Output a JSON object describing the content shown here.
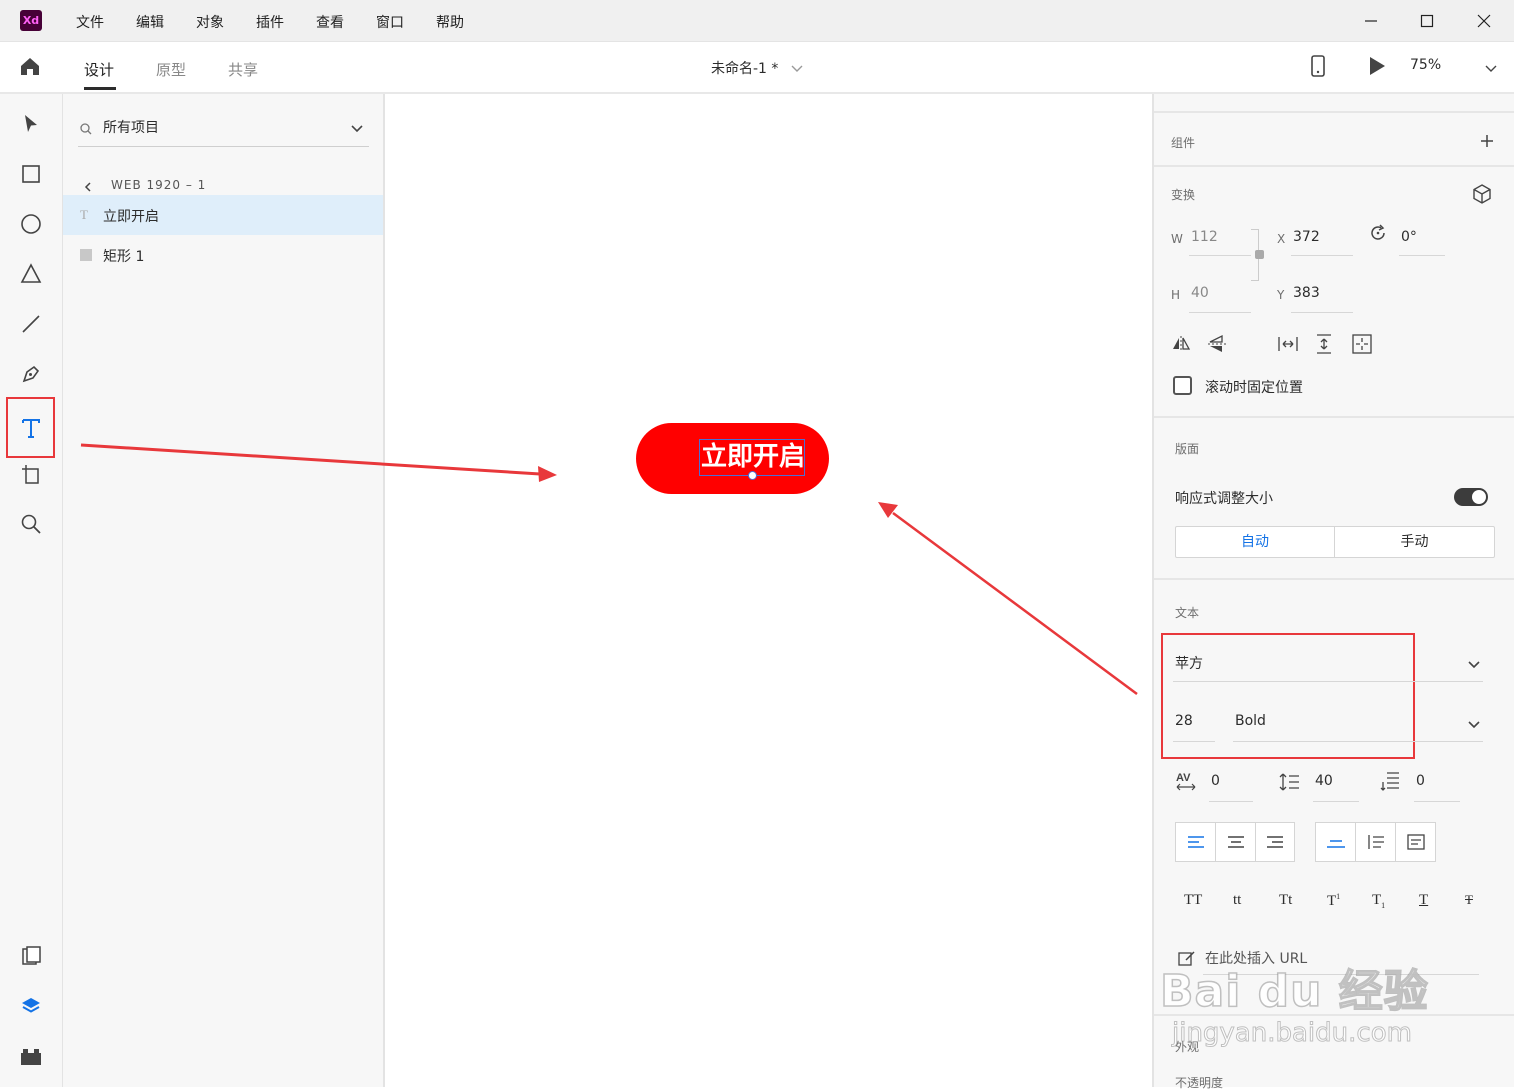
{
  "app": {
    "logo": "Xd",
    "colors": {
      "accent": "#1473e6",
      "button_red": "#ff0000",
      "annotation": "#e8383b"
    }
  },
  "menu": [
    "文件",
    "编辑",
    "对象",
    "插件",
    "查看",
    "窗口",
    "帮助"
  ],
  "tabs": [
    "设计",
    "原型",
    "共享"
  ],
  "doc_title": "未命名-1 *",
  "zoom": "75%",
  "layers": {
    "search_label": "所有项目",
    "artboard": "WEB 1920 – 1",
    "items": [
      {
        "label": "立即开启",
        "type": "text"
      },
      {
        "label": "矩形 1",
        "type": "rect"
      }
    ]
  },
  "canvas": {
    "button_text": "立即开启"
  },
  "props": {
    "components_label": "组件",
    "transform_label": "变换",
    "w_label": "W",
    "w": "112",
    "x_label": "X",
    "x": "372",
    "rotation": "0°",
    "h_label": "H",
    "h": "40",
    "y_label": "Y",
    "y": "383",
    "fix_scroll_label": "滚动时固定位置",
    "layout_label": "版面",
    "responsive_label": "响应式调整大小",
    "auto_label": "自动",
    "manual_label": "手动",
    "text_label": "文本",
    "font_family": "苹方",
    "font_size": "28",
    "font_weight": "Bold",
    "char_spacing": "0",
    "line_spacing": "40",
    "para_spacing": "0",
    "url_label": "在此处插入 URL",
    "appearance_label": "外观",
    "opacity_label": "不透明度"
  },
  "watermark": {
    "brand": "Bai du 经验",
    "url": "jingyan.baidu.com"
  }
}
